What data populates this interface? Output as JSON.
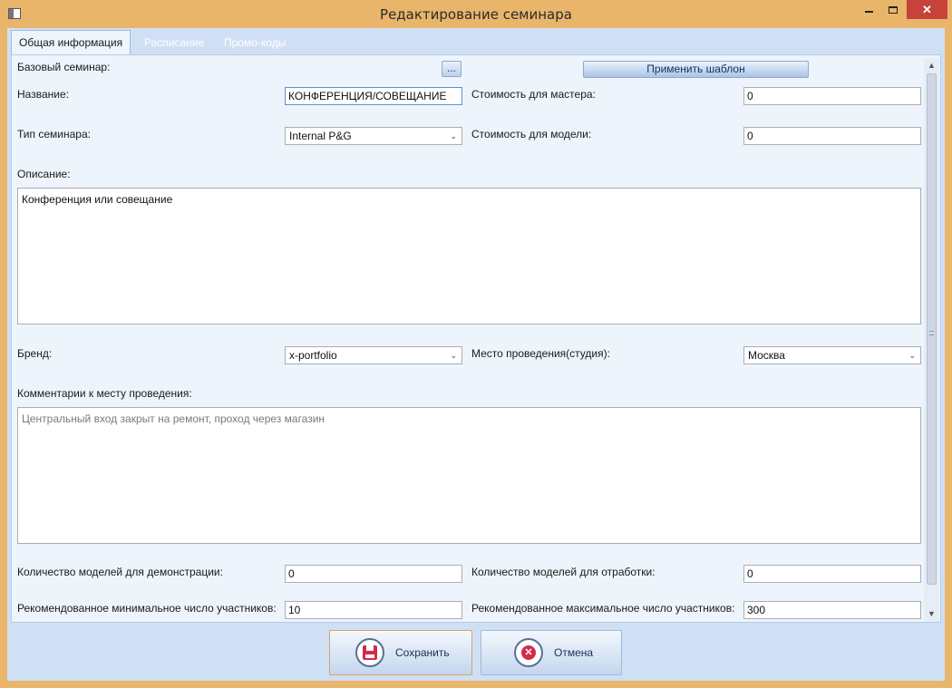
{
  "window": {
    "title": "Редактирование семинара",
    "minimize": "–",
    "maximize": "□",
    "close": "✕"
  },
  "tabs": [
    {
      "label": "Общая информация",
      "active": true
    },
    {
      "label": "Расписание",
      "active": false
    },
    {
      "label": "Промо-коды",
      "active": false
    }
  ],
  "form": {
    "base_seminar": {
      "label": "Базовый семинар:",
      "browse_label": "...",
      "apply_template_label": "Применить шаблон"
    },
    "name": {
      "label": "Название:",
      "value": "КОНФЕРЕНЦИЯ/СОВЕЩАНИЕ"
    },
    "master_cost": {
      "label": "Стоимость для мастера:",
      "value": "0"
    },
    "seminar_type": {
      "label": "Тип семинара:",
      "value": "Internal P&G"
    },
    "model_cost": {
      "label": "Стоимость для модели:",
      "value": "0"
    },
    "description": {
      "label": "Описание:",
      "value": "Конференция или совещание"
    },
    "brand": {
      "label": "Бренд:",
      "value": "x-portfolio"
    },
    "venue": {
      "label": "Место проведения(студия):",
      "value": "Москва"
    },
    "venue_comments": {
      "label": "Комментарии к месту проведения:",
      "placeholder": "Центральный вход закрыт на ремонт, проход через магазин"
    },
    "demo_models": {
      "label": "Количество моделей для демонстрации:",
      "value": "0"
    },
    "practice_models": {
      "label": "Количество моделей для отработки:",
      "value": "0"
    },
    "min_participants": {
      "label": "Рекомендованное минимальное число участников:",
      "value": "10"
    },
    "max_participants": {
      "label": "Рекомендованное максимальное число участников:",
      "value": "300"
    }
  },
  "footer": {
    "save_label": "Сохранить",
    "cancel_label": "Отмена"
  },
  "colors": {
    "window_frame": "#e8b56a",
    "client_bg": "#cfe0f5",
    "panel_bg": "#eef4fb",
    "close_button": "#c7423a",
    "icon_red": "#d42a4a"
  }
}
